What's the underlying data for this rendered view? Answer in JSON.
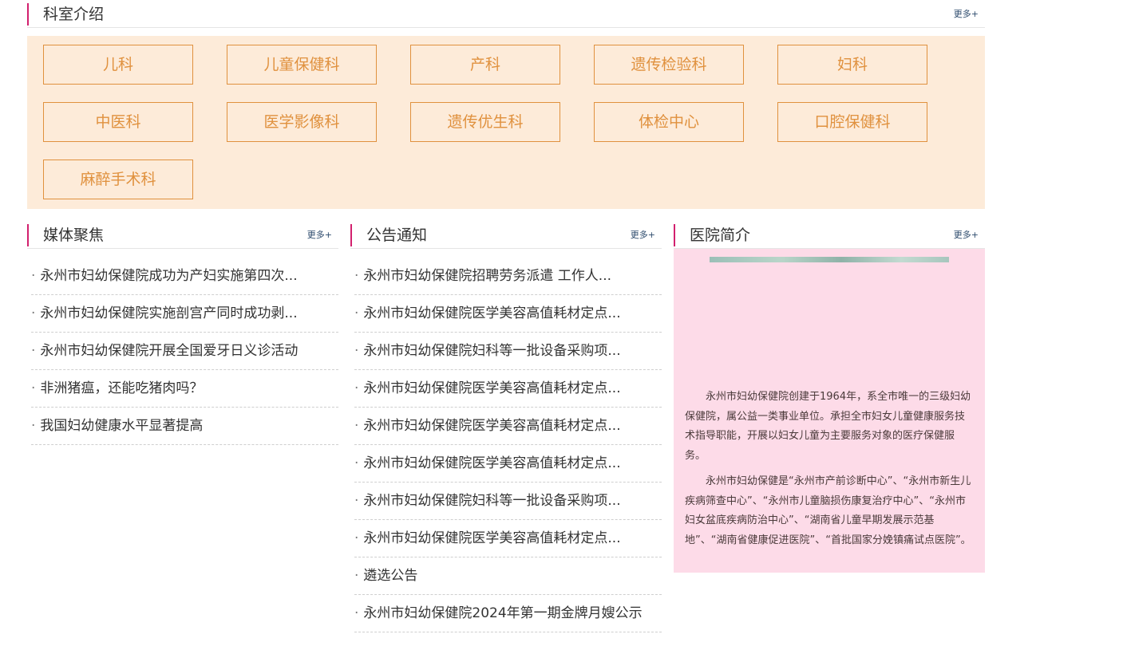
{
  "departments": {
    "title": "科室介绍",
    "more": "更多+",
    "items": [
      "儿科",
      "儿童保健科",
      "产科",
      "遗传检验科",
      "妇科",
      "中医科",
      "医学影像科",
      "遗传优生科",
      "体检中心",
      "口腔保健科",
      "麻醉手术科"
    ]
  },
  "media": {
    "title": "媒体聚焦",
    "more": "更多+",
    "items": [
      "永州市妇幼保健院成功为产妇实施第四次...",
      "永州市妇幼保健院实施剖宫产同时成功剥...",
      "永州市妇幼保健院开展全国爱牙日义诊活动",
      "非洲猪瘟，还能吃猪肉吗？",
      "我国妇幼健康水平显著提高"
    ]
  },
  "notices": {
    "title": "公告通知",
    "more": "更多+",
    "items": [
      "永州市妇幼保健院招聘劳务派遣 工作人...",
      "永州市妇幼保健院医学美容高值耗材定点...",
      "永州市妇幼保健院妇科等一批设备采购项...",
      "永州市妇幼保健院医学美容高值耗材定点...",
      "永州市妇幼保健院医学美容高值耗材定点...",
      "永州市妇幼保健院医学美容高值耗材定点...",
      "永州市妇幼保健院妇科等一批设备采购项...",
      "永州市妇幼保健院医学美容高值耗材定点...",
      "遴选公告",
      "永州市妇幼保健院2024年第一期金牌月嫂公示"
    ]
  },
  "intro": {
    "title": "医院简介",
    "more": "更多+",
    "paragraph1": "永州市妇幼保健院创建于1964年，系全市唯一的三级妇幼保健院，属公益一类事业单位。承担全市妇女儿童健康服务技术指导职能，开展以妇女儿童为主要服务对象的医疗保健服务。",
    "paragraph2": "永州市妇幼保健是“永州市产前诊断中心”、“永州市新生儿疾病筛查中心”、“永州市儿童脑损伤康复治疗中心”、“永州市妇女盆底疾病防治中心”、“湖南省儿童早期发展示范基地”、“湖南省健康促进医院”、“首批国家分娩镇痛试点医院”。"
  },
  "colors": {
    "accent": "#d2206e",
    "dept_panel_bg": "#fdebd9",
    "dept_border": "#e0913e",
    "intro_bg": "#fddbe8"
  }
}
